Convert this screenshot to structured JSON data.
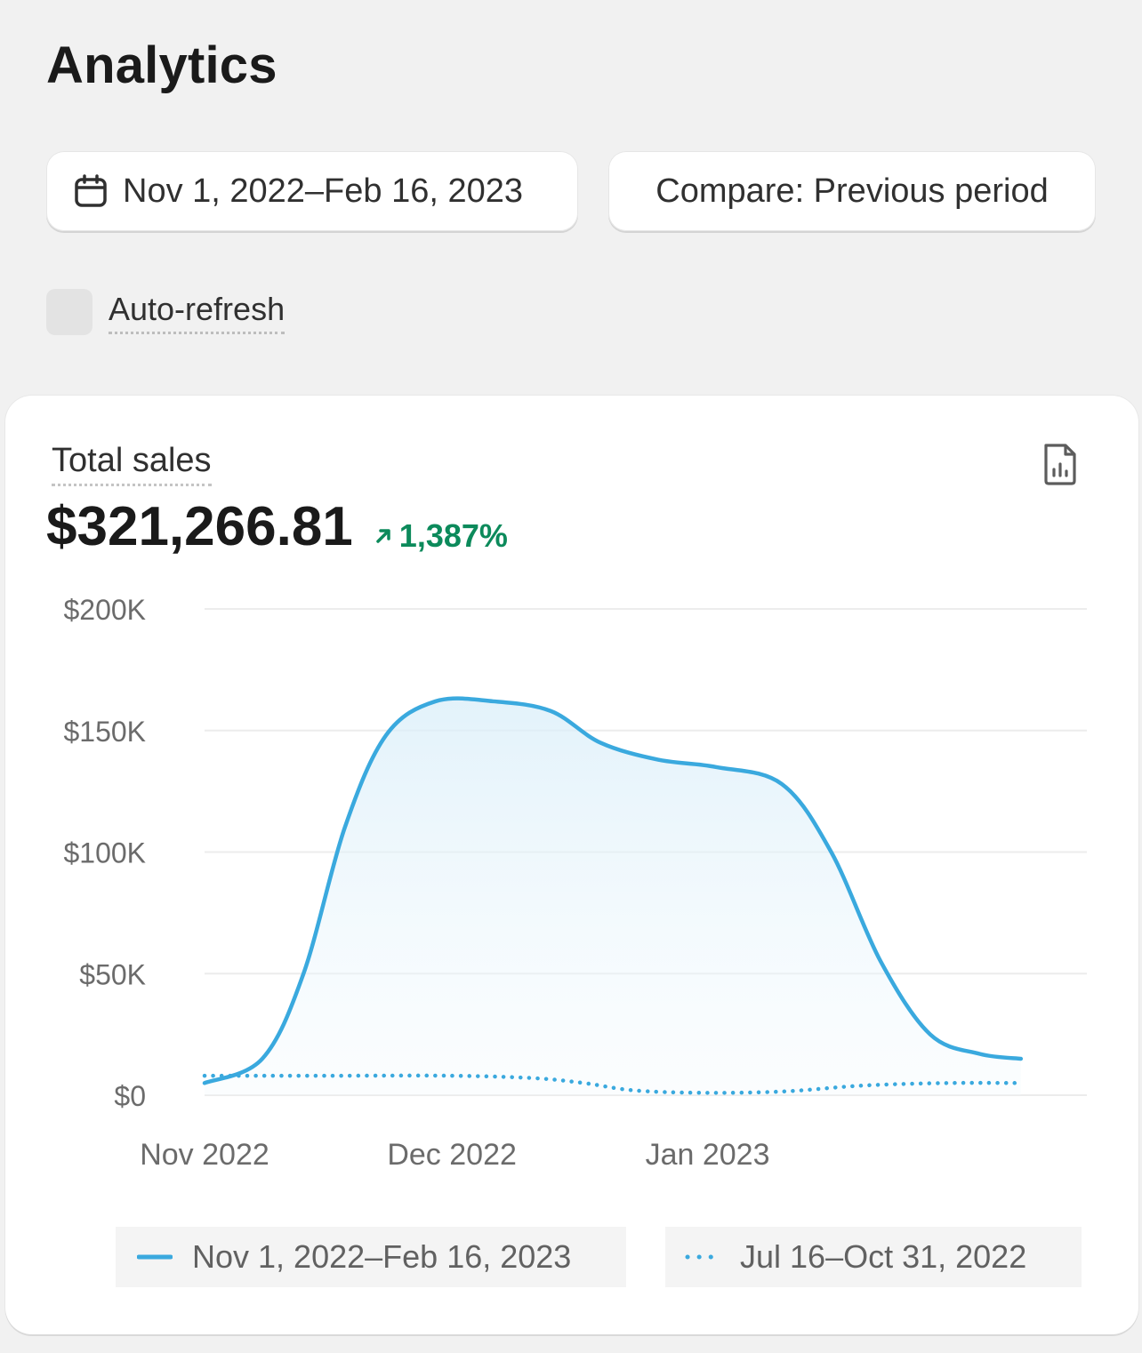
{
  "page": {
    "title": "Analytics"
  },
  "toolbar": {
    "date_range_label": "Nov 1, 2022–Feb 16, 2023",
    "compare_label": "Compare: Previous period",
    "calendar_icon": "calendar-icon"
  },
  "auto_refresh": {
    "label": "Auto-refresh",
    "checked": false
  },
  "card": {
    "metric_title": "Total sales",
    "metric_value": "$321,266.81",
    "metric_change": "1,387%",
    "change_direction": "up",
    "export_icon": "export-report-icon"
  },
  "colors": {
    "primary_series": "#3aa9de",
    "comparison_series": "#3aa9de",
    "positive_change": "#0c8a5b"
  },
  "chart_data": {
    "type": "area",
    "x_tick_labels": [
      "Nov 2022",
      "Dec 2022",
      "Jan 2023"
    ],
    "x_tick_days": [
      0,
      30,
      61
    ],
    "x_range_days": [
      0,
      107
    ],
    "y_tick_labels": [
      "$0",
      "$50K",
      "$100K",
      "$150K",
      "$200K"
    ],
    "y_tick_values": [
      0,
      50000,
      100000,
      150000,
      200000
    ],
    "ylim": [
      0,
      200000
    ],
    "grid": true,
    "legend_placement": "bottom",
    "series": [
      {
        "name": "Nov 1, 2022–Feb 16, 2023",
        "style": "solid",
        "filled": true,
        "points": [
          [
            0,
            5000
          ],
          [
            7,
            15000
          ],
          [
            12,
            50000
          ],
          [
            17,
            110000
          ],
          [
            22,
            148000
          ],
          [
            28,
            162000
          ],
          [
            35,
            162000
          ],
          [
            42,
            158000
          ],
          [
            48,
            145000
          ],
          [
            55,
            138000
          ],
          [
            62,
            135000
          ],
          [
            70,
            128000
          ],
          [
            76,
            100000
          ],
          [
            82,
            55000
          ],
          [
            88,
            25000
          ],
          [
            94,
            17000
          ],
          [
            99,
            15000
          ]
        ]
      },
      {
        "name": "Jul 16–Oct 31, 2022",
        "style": "dotted",
        "filled": false,
        "points": [
          [
            0,
            8000
          ],
          [
            15,
            8000
          ],
          [
            30,
            8000
          ],
          [
            40,
            7000
          ],
          [
            46,
            5000
          ],
          [
            52,
            2000
          ],
          [
            60,
            1000
          ],
          [
            70,
            1500
          ],
          [
            80,
            4000
          ],
          [
            90,
            5000
          ],
          [
            99,
            5000
          ]
        ]
      }
    ]
  }
}
